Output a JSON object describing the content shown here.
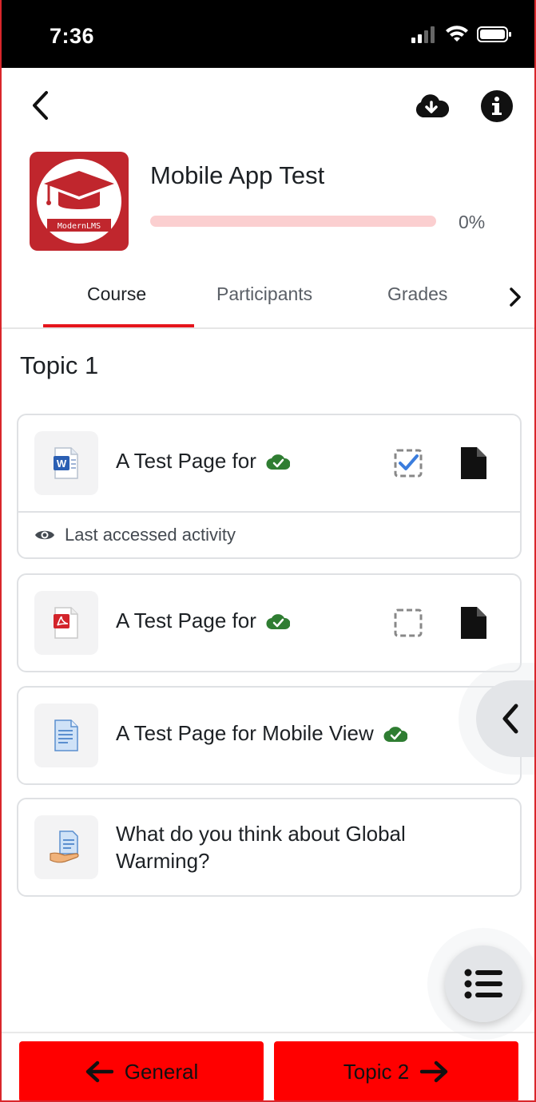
{
  "status_bar": {
    "time": "7:36"
  },
  "course": {
    "title": "Mobile App Test",
    "logo_text": "ModernLMS",
    "progress_text": "0%",
    "progress_value": 0
  },
  "tabs": [
    {
      "label": "Course",
      "active": true
    },
    {
      "label": "Participants",
      "active": false
    },
    {
      "label": "Grades",
      "active": false
    }
  ],
  "topic": {
    "title": "Topic 1"
  },
  "modules": [
    {
      "name": "A Test Page for",
      "icon": "word-document-icon",
      "downloaded": true,
      "completion": "checked",
      "last_accessed": "Last accessed activity"
    },
    {
      "name": "A Test Page for",
      "icon": "pdf-document-icon",
      "downloaded": true,
      "completion": "unchecked"
    },
    {
      "name": "A Test Page for Mobile View",
      "icon": "page-document-icon",
      "downloaded": true
    },
    {
      "name": "What do you think about Global Warming?",
      "icon": "feedback-hand-icon"
    }
  ],
  "bottom_nav": {
    "prev_label": "General",
    "next_label": "Topic 2"
  },
  "colors": {
    "accent": "#e5141c",
    "nav_button": "#ff0000",
    "success": "#2f7d32",
    "complete": "#3b7ddd"
  }
}
